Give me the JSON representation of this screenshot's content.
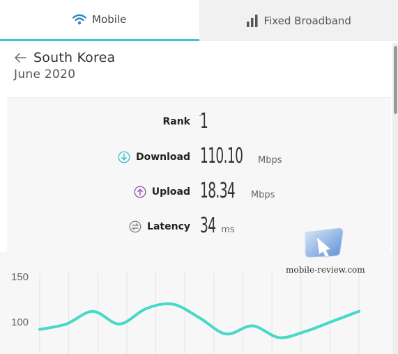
{
  "tabs": [
    {
      "label": "Mobile",
      "icon": "wifi-icon",
      "active": true
    },
    {
      "label": "Fixed Broadband",
      "icon": "bars-icon",
      "active": false
    }
  ],
  "header": {
    "country": "South Korea",
    "date": "June 2020"
  },
  "stats": {
    "rank": {
      "label": "Rank",
      "value": "1",
      "change": "-"
    },
    "download": {
      "label": "Download",
      "value": "110.10",
      "unit": "Mbps"
    },
    "upload": {
      "label": "Upload",
      "value": "18.34",
      "unit": "Mbps"
    },
    "latency": {
      "label": "Latency",
      "value": "34",
      "unit": "ms"
    }
  },
  "watermark": {
    "text": "mobile-review.com"
  },
  "colors": {
    "accent": "#3ec4cf",
    "download_icon": "#3ec4cf",
    "upload_icon": "#9b59b6",
    "latency_icon": "#888888",
    "line": "#46d8c8"
  },
  "chart_data": {
    "type": "line",
    "y_ticks": [
      "150",
      "100"
    ],
    "ylim": [
      60,
      160
    ],
    "series": [
      {
        "values": [
          91,
          97,
          111,
          97,
          114,
          119,
          104,
          86,
          95,
          82,
          89,
          100,
          111
        ]
      }
    ]
  }
}
